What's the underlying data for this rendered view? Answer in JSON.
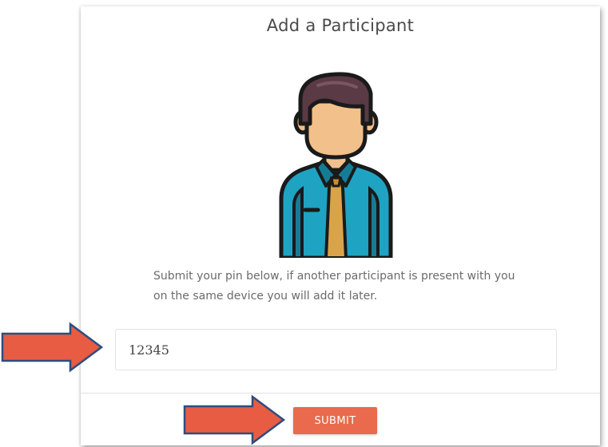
{
  "card": {
    "title": "Add a Participant",
    "instructions_line1": "Submit your pin below, if another participant is present with you",
    "instructions_line2": "on the same device you will add it later."
  },
  "pin_input": {
    "value": "12345"
  },
  "submit": {
    "label": "SUBMIT"
  },
  "icons": {
    "avatar": "participant-avatar-icon",
    "annotation": "arrow-right-icon"
  },
  "colors": {
    "accent": "#e96a4c",
    "arrow_fill": "#e85c43",
    "arrow_stroke": "#2f4d7e",
    "shirt": "#1fa3c2",
    "hair": "#5a3a45",
    "skin": "#f2c08a",
    "tie": "#d9a449"
  }
}
